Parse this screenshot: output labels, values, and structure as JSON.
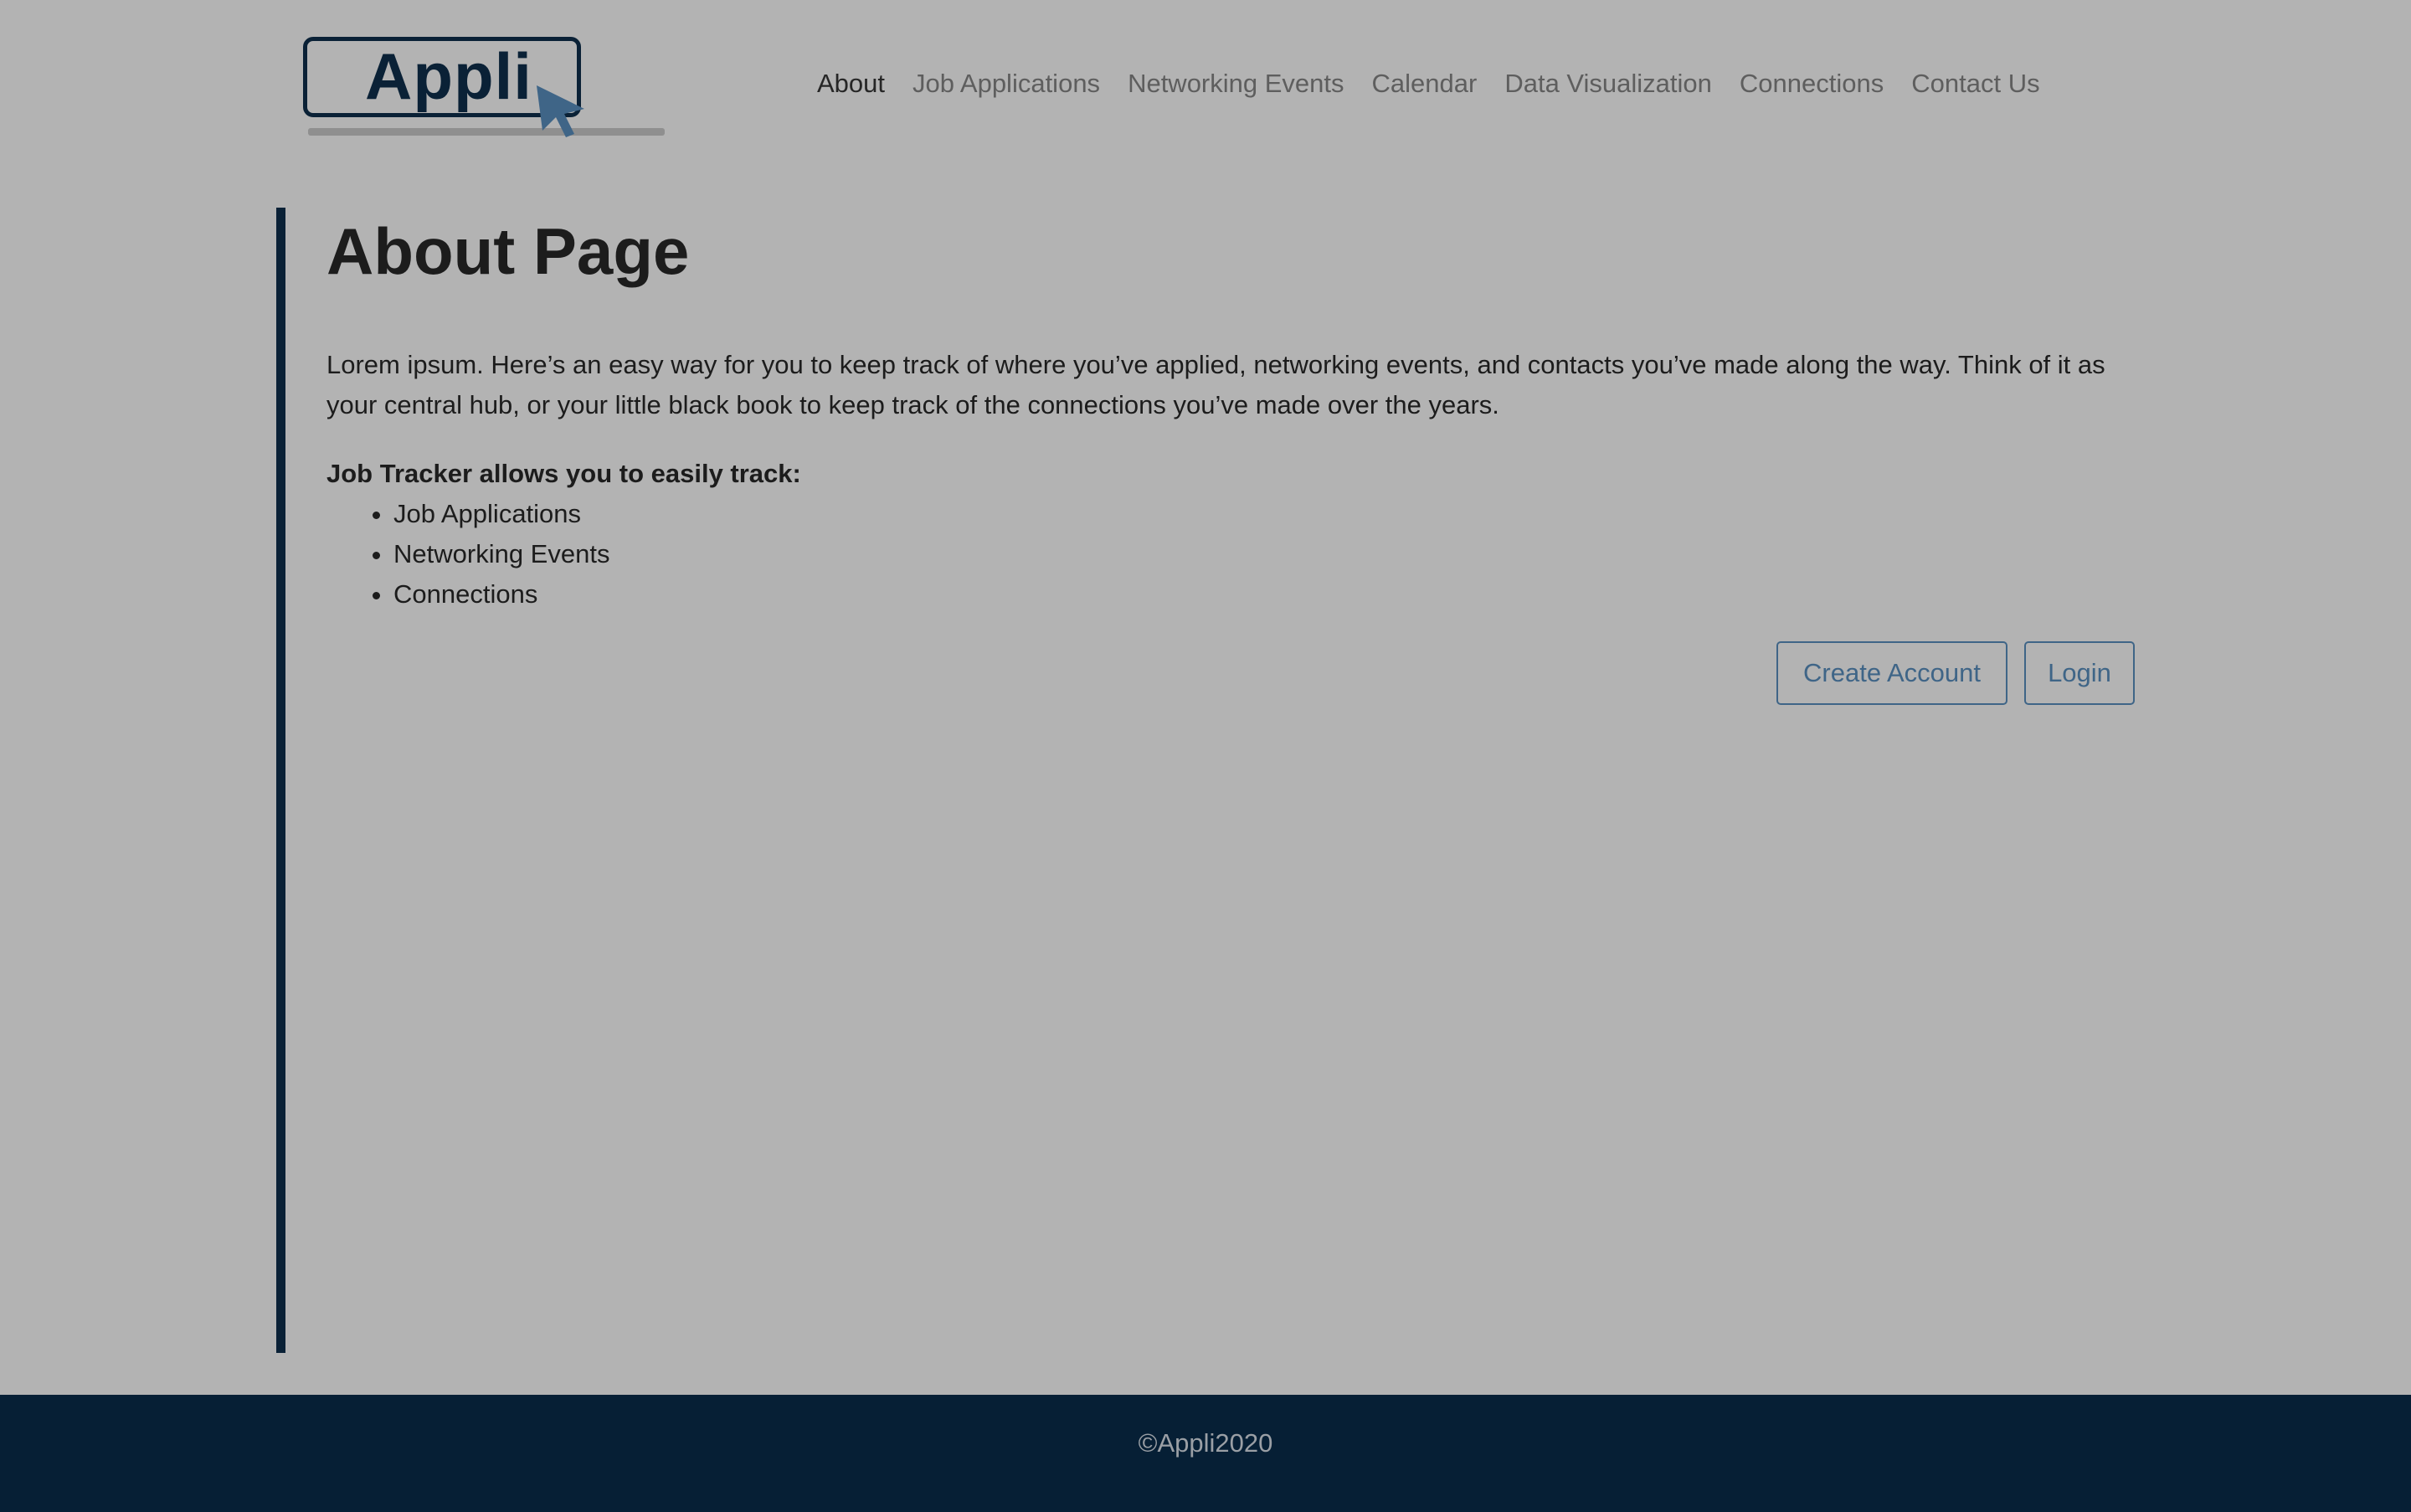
{
  "header": {
    "logo_text": "Appli",
    "nav": [
      {
        "label": "About",
        "active": true
      },
      {
        "label": "Job Applications",
        "active": false
      },
      {
        "label": "Networking Events",
        "active": false
      },
      {
        "label": "Calendar",
        "active": false
      },
      {
        "label": "Data Visualization",
        "active": false
      },
      {
        "label": "Connections",
        "active": false
      },
      {
        "label": "Contact Us",
        "active": false
      }
    ]
  },
  "main": {
    "title": "About Page",
    "intro": "Lorem ipsum. Here’s an easy way for you to keep track of where you’ve applied, networking events, and contacts you’ve made along the way. Think of it as your central hub, or your little black book to keep track of the connections you’ve made over the years.",
    "track_heading": "Job Tracker allows you to easily track:",
    "track_items": [
      "Job Applications",
      "Networking Events",
      "Connections"
    ],
    "buttons": {
      "create_account": "Create Account",
      "login": "Login"
    }
  },
  "footer": {
    "text": "©Appli2020"
  },
  "colors": {
    "background": "#b3b3b3",
    "brand_navy": "#0a2136",
    "accent_blue": "#3f6587",
    "footer_bg": "#061f35"
  },
  "icons": {
    "logo_cursor": "cursor-arrow-icon"
  }
}
